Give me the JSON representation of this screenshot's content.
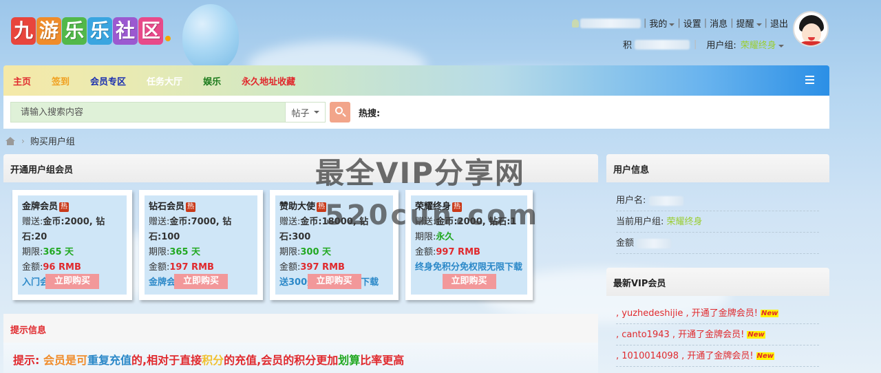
{
  "logo": {
    "chars": [
      "九",
      "游",
      "乐",
      "乐",
      "社",
      "区"
    ],
    "colors": [
      "#e8453c",
      "#f08c2a",
      "#52b84a",
      "#3aa5e0",
      "#9b59d0",
      "#e84a8a"
    ]
  },
  "topbar": {
    "my_label": "我的",
    "settings_label": "设置",
    "messages_label": "消息",
    "remind_label": "提醒",
    "logout_label": "退出",
    "points_label": "积",
    "usergroup_label": "用户组:",
    "usergroup_value": "荣耀终身"
  },
  "nav": {
    "items": [
      {
        "label": "主页",
        "color": "#e0292d"
      },
      {
        "label": "签到",
        "color": "#f0a020"
      },
      {
        "label": "会员专区",
        "color": "#1a2fb0"
      },
      {
        "label": "任务大厅",
        "color": "#ffffff"
      },
      {
        "label": "娱乐",
        "color": "#1b7a1b"
      },
      {
        "label": "永久地址收藏",
        "color": "#e0292d"
      }
    ]
  },
  "search": {
    "placeholder": "请输入搜索内容",
    "type_value": "帖子",
    "hot_label": "热搜:"
  },
  "breadcrumb": {
    "current": "购买用户组"
  },
  "main": {
    "title": "开通用户组会员",
    "hot_tag": "热",
    "buy_label": "立即购买",
    "cards": [
      {
        "name": "金牌会员",
        "gift_label": "赠送:",
        "gift": "金币:2000, 钻石:20",
        "period_label": "期限:",
        "period": "365 天",
        "price_label": "金额:",
        "price": "96 RMB",
        "desc": "入门会员"
      },
      {
        "name": "钻石会员",
        "gift_label": "赠送:",
        "gift": "金币:7000, 钻石:100",
        "period_label": "期限:",
        "period": "365 天",
        "price_label": "金额:",
        "price": "197 RMB",
        "desc": "金牌会员3.5倍"
      },
      {
        "name": "赞助大使",
        "gift_label": "赠送:",
        "gift": "金币:18000, 钻石:300",
        "period_label": "期限:",
        "period": "300 天",
        "price_label": "金额:",
        "price": "397 RMB",
        "desc": "送300天免积分无限下载"
      },
      {
        "name": "荣耀终身",
        "gift_label": "赠送:",
        "gift": "金币:2000, 钻石:1",
        "period_label": "期限:",
        "period": "永久",
        "price_label": "金额:",
        "price": "997 RMB",
        "desc": "终身免积分免权限无限下载"
      }
    ]
  },
  "tips": {
    "title": "提示信息",
    "segments": [
      {
        "text": "提示:",
        "color": "#e0292d"
      },
      {
        "text": "会员是可",
        "color": "#f08c2a"
      },
      {
        "text": "重复充值",
        "color": "#2b88c8"
      },
      {
        "text": "的,相对于直接",
        "color": "#e0292d"
      },
      {
        "text": "积分",
        "color": "#f0c030"
      },
      {
        "text": "的充值,会员的积分更加",
        "color": "#e0292d"
      },
      {
        "text": "划算",
        "color": "#22a822"
      },
      {
        "text": "比率更高",
        "color": "#e0292d"
      }
    ]
  },
  "sidebar": {
    "userinfo_title": "用户信息",
    "username_label": "用户名:",
    "group_label": "当前用户组:",
    "group_value": "荣耀终身",
    "amount_label": "金额",
    "vip_title": "最新VIP会员",
    "vip_items": [
      {
        "text": ", yuzhedeshijie , 开通了金牌会员!",
        "tag": "New"
      },
      {
        "text": ", canto1943 , 开通了金牌会员!",
        "tag": "New"
      },
      {
        "text": ", 1010014098 , 开通了金牌会员!",
        "tag": "New"
      }
    ]
  },
  "watermark": {
    "line1": "最全VIP分享网",
    "line2": "520cun.com"
  }
}
